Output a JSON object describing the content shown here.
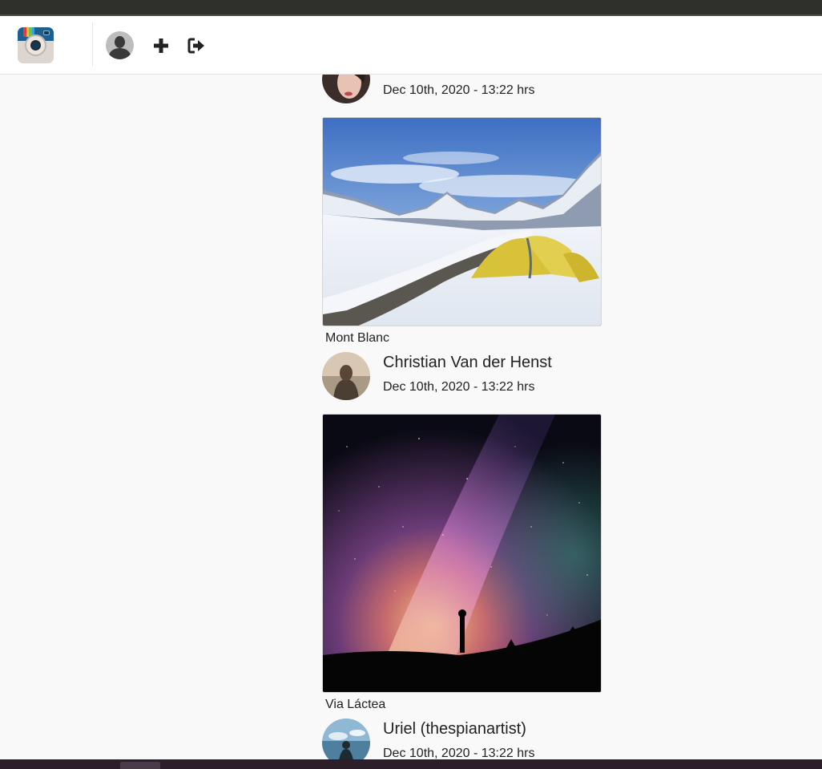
{
  "header": {
    "logo_icon": "camera-logo-icon",
    "profile_icon": "user-avatar-icon",
    "add_icon": "plus-icon",
    "logout_icon": "sign-out-icon"
  },
  "posts": [
    {
      "author": "",
      "date": "Dec 10th, 2020 - 13:22 hrs",
      "caption": "Mont Blanc",
      "image_subject": "snowy-mountain-camp"
    },
    {
      "author": "Christian Van der Henst",
      "date": "Dec 10th, 2020 - 13:22 hrs",
      "caption": "Via Láctea",
      "image_subject": "milky-way-silhouette"
    },
    {
      "author": "Uriel (thespianartist)",
      "date": "Dec 10th, 2020 - 13:22 hrs",
      "caption": "",
      "image_subject": ""
    }
  ],
  "colors": {
    "background": "#f9f9f9",
    "navbar": "#ffffff",
    "text": "#222222"
  }
}
